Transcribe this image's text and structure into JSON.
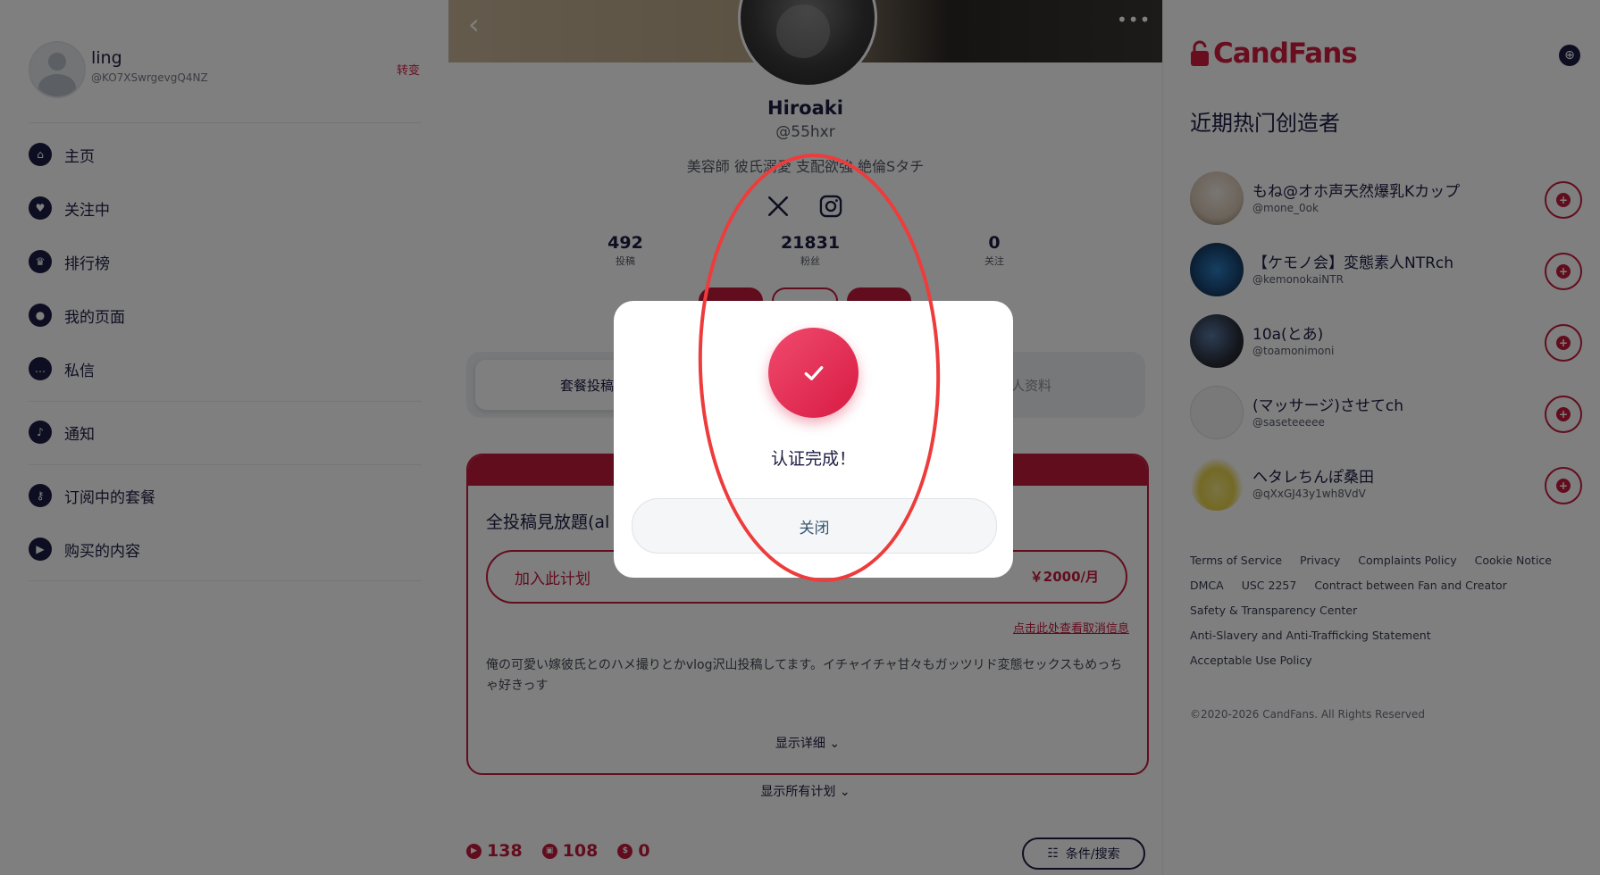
{
  "sidebar": {
    "user": {
      "name": "ling",
      "handle": "@KO7XSwrgevgQ4NZ",
      "switch_label": "转变"
    },
    "nav": [
      {
        "label": "主页",
        "icon": "home-icon"
      },
      {
        "label": "关注中",
        "icon": "heart-icon"
      },
      {
        "label": "排行榜",
        "icon": "crown-icon"
      },
      {
        "label": "我的页面",
        "icon": "person-icon"
      },
      {
        "label": "私信",
        "icon": "chat-icon"
      },
      {
        "label": "通知",
        "icon": "bell-icon"
      },
      {
        "label": "订阅中的套餐",
        "icon": "key-icon"
      },
      {
        "label": "购买的内容",
        "icon": "play-icon"
      }
    ]
  },
  "profile": {
    "name": "Hiroaki",
    "handle": "@55hxr",
    "bio": "美容師 彼氏溺愛 支配欲強 絶倫Sタチ",
    "stats": [
      {
        "value": "492",
        "label": "投稿"
      },
      {
        "value": "21831",
        "label": "粉丝"
      },
      {
        "value": "0",
        "label": "关注"
      }
    ],
    "tabs": [
      {
        "label": "套餐投稿"
      },
      {
        "label": "个人资料"
      }
    ],
    "plan": {
      "title": "全投稿見放題(al",
      "join_label": "加入此计划",
      "price": "￥2000/月",
      "cancel_info": "点击此处查看取消信息",
      "description": "俺の可愛い嫁彼氏とのハメ撮りとかvlog沢山投稿してます。イチャイチャ甘々もガッツリド変態セックスもめっちゃ好きっす",
      "show_detail": "显示详细"
    },
    "show_all_plans": "显示所有计划",
    "counters": [
      {
        "icon": "video-icon",
        "value": "138"
      },
      {
        "icon": "image-icon",
        "value": "108"
      },
      {
        "icon": "price-icon",
        "value": "0"
      }
    ],
    "filter_label": "条件/搜索"
  },
  "right": {
    "logo_text": "CandFans",
    "trending_title": "近期热门创造者",
    "creators": [
      {
        "name": "もね@オホ声天然爆乳Kカップ",
        "handle": "@mone_0ok",
        "avatar_color": "#d9c8b6"
      },
      {
        "name": "【ケモノ会】変態素人NTRch",
        "handle": "@kemonokaiNTR",
        "avatar_color": "#1a4a7a"
      },
      {
        "name": "10a(とあ)",
        "handle": "@toamonimoni",
        "avatar_color": "#2a2f3a"
      },
      {
        "name": "(マッサージ)させてch",
        "handle": "@saseteeeee",
        "avatar_color": "#f2f2f2"
      },
      {
        "name": "ヘタレちんぽ桑田",
        "handle": "@qXxGJ43y1wh8VdV",
        "avatar_color": "#e8d24a"
      }
    ],
    "footer": [
      [
        "Terms of Service",
        "Privacy",
        "Complaints Policy",
        "Cookie Notice"
      ],
      [
        "DMCA",
        "USC 2257",
        "Contract between Fan and Creator"
      ],
      [
        "Safety & Transparency Center"
      ],
      [
        "Anti-Slavery and Anti-Trafficking Statement"
      ],
      [
        "Acceptable Use Policy"
      ]
    ],
    "copyright": "©2020-2026 CandFans. All Rights Reserved"
  },
  "modal": {
    "message": "认证完成！",
    "close_label": "关闭",
    "accent_color": "#d81b43"
  }
}
